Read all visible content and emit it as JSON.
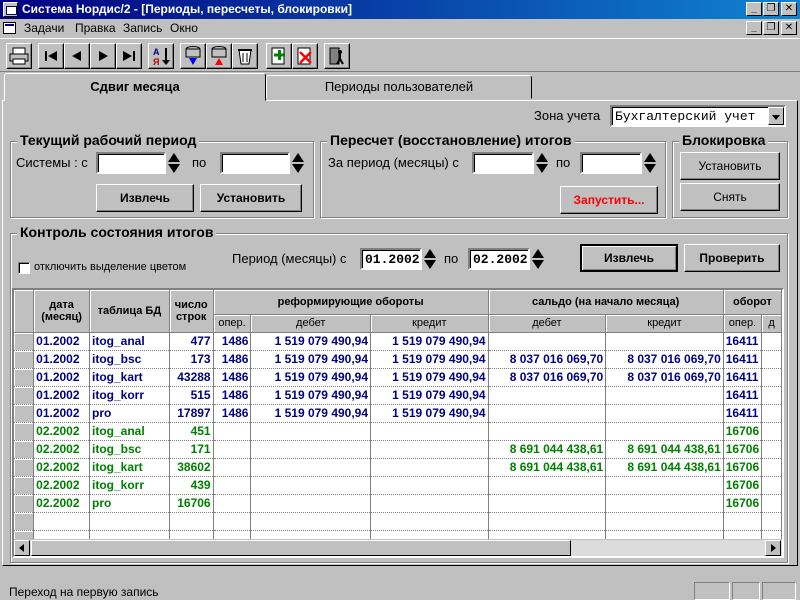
{
  "window": {
    "title": "Система Нордис/2 - [Периоды, пересчеты, блокировки]"
  },
  "menu": {
    "items": [
      "Задачи",
      "Правка",
      "Запись",
      "Окно"
    ]
  },
  "toolbar": {
    "buttons": [
      "printer-icon",
      "first-record-icon",
      "prev-record-icon",
      "next-record-icon",
      "last-record-icon",
      "sort-az-icon",
      "db-down-icon",
      "db-up-icon",
      "clear-icon",
      "new-icon",
      "delete-icon",
      "exit-icon"
    ]
  },
  "tabs": [
    "Сдвиг месяца",
    "Периоды пользователей"
  ],
  "zone": {
    "label": "Зона учета",
    "value": "Бухгалтерский учет"
  },
  "current_period": {
    "title": "Текущий рабочий период",
    "system_from_label": "Системы : с",
    "to_label": "по",
    "from_value": "",
    "to_value": "",
    "fetch_button": "Извлечь",
    "set_button": "Установить"
  },
  "recalc": {
    "title": "Пересчет (восстановление) итогов",
    "period_label": "За период (месяцы) с",
    "to_label": "по",
    "from_value": "",
    "to_value": "",
    "run_button": "Запустить..."
  },
  "lock": {
    "title": "Блокировка",
    "set_button": "Установить",
    "remove_button": "Снять"
  },
  "control": {
    "title": "Контроль состояния итогов",
    "checkbox_label": "отключить выделение цветом",
    "checkbox_checked": false,
    "period_label": "Период (месяцы) с",
    "to_label": "по",
    "from_value": "01.2002",
    "to_value": "02.2002",
    "fetch_button": "Извлечь",
    "check_button": "Проверить"
  },
  "grid": {
    "headers": {
      "date": "дата (месяц)",
      "table": "таблица БД",
      "count": "число строк",
      "reform": "реформирующие обороты",
      "saldo": "сальдо (на начало месяца)",
      "turnover": "оборот",
      "oper": "опер.",
      "debit": "дебет",
      "credit": "кредит",
      "d": "д"
    },
    "rows": [
      {
        "color": "blue",
        "date": "01.2002",
        "table": "itog_anal",
        "count": "477",
        "oper": "1486",
        "r_debit": "1 519 079 490,94",
        "r_credit": "1 519 079 490,94",
        "s_debit": "",
        "s_credit": "",
        "t_oper": "16411"
      },
      {
        "color": "blue",
        "date": "01.2002",
        "table": "itog_bsc",
        "count": "173",
        "oper": "1486",
        "r_debit": "1 519 079 490,94",
        "r_credit": "1 519 079 490,94",
        "s_debit": "8 037 016 069,70",
        "s_credit": "8 037 016 069,70",
        "t_oper": "16411"
      },
      {
        "color": "blue",
        "date": "01.2002",
        "table": "itog_kart",
        "count": "43288",
        "oper": "1486",
        "r_debit": "1 519 079 490,94",
        "r_credit": "1 519 079 490,94",
        "s_debit": "8 037 016 069,70",
        "s_credit": "8 037 016 069,70",
        "t_oper": "16411"
      },
      {
        "color": "blue",
        "date": "01.2002",
        "table": "itog_korr",
        "count": "515",
        "oper": "1486",
        "r_debit": "1 519 079 490,94",
        "r_credit": "1 519 079 490,94",
        "s_debit": "",
        "s_credit": "",
        "t_oper": "16411"
      },
      {
        "color": "blue",
        "date": "01.2002",
        "table": "pro",
        "count": "17897",
        "oper": "1486",
        "r_debit": "1 519 079 490,94",
        "r_credit": "1 519 079 490,94",
        "s_debit": "",
        "s_credit": "",
        "t_oper": "16411"
      },
      {
        "color": "green",
        "date": "02.2002",
        "table": "itog_anal",
        "count": "451",
        "oper": "",
        "r_debit": "",
        "r_credit": "",
        "s_debit": "",
        "s_credit": "",
        "t_oper": "16706"
      },
      {
        "color": "green",
        "date": "02.2002",
        "table": "itog_bsc",
        "count": "171",
        "oper": "",
        "r_debit": "",
        "r_credit": "",
        "s_debit": "8 691 044 438,61",
        "s_credit": "8 691 044 438,61",
        "t_oper": "16706"
      },
      {
        "color": "green",
        "date": "02.2002",
        "table": "itog_kart",
        "count": "38602",
        "oper": "",
        "r_debit": "",
        "r_credit": "",
        "s_debit": "8 691 044 438,61",
        "s_credit": "8 691 044 438,61",
        "t_oper": "16706"
      },
      {
        "color": "green",
        "date": "02.2002",
        "table": "itog_korr",
        "count": "439",
        "oper": "",
        "r_debit": "",
        "r_credit": "",
        "s_debit": "",
        "s_credit": "",
        "t_oper": "16706"
      },
      {
        "color": "green",
        "date": "02.2002",
        "table": "pro",
        "count": "16706",
        "oper": "",
        "r_debit": "",
        "r_credit": "",
        "s_debit": "",
        "s_credit": "",
        "t_oper": "16706"
      }
    ],
    "empty_rows": 2
  },
  "status": {
    "text": "Переход на первую запись"
  },
  "colors": {
    "row_blue": "#000080",
    "row_green": "#008000",
    "run_button_text": "#ff0000",
    "titlebar": "#000080"
  }
}
